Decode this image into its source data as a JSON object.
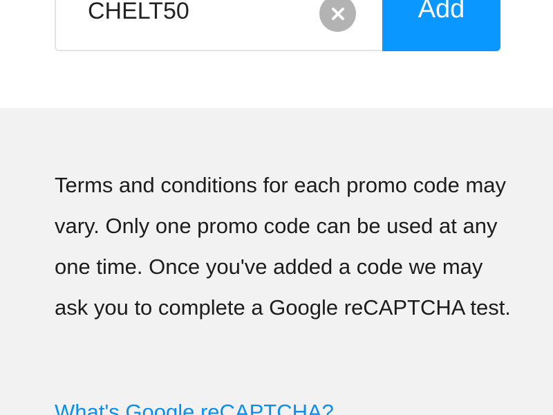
{
  "promo": {
    "code_value": "CHELT50",
    "clear_icon": "close-icon",
    "add_label": "Add"
  },
  "info": {
    "terms_text": "Terms and conditions for each promo code may vary. Only one promo code can be used at any one time. Once you've added a code we may ask you to complete a Google reCAPTCHA test.",
    "recaptcha_link": "What's Google reCAPTCHA?"
  },
  "colors": {
    "accent": "#0a97ff",
    "link": "#0a8ff0",
    "info_background": "#f2f2f2",
    "clear_button": "#b3b3b3"
  }
}
